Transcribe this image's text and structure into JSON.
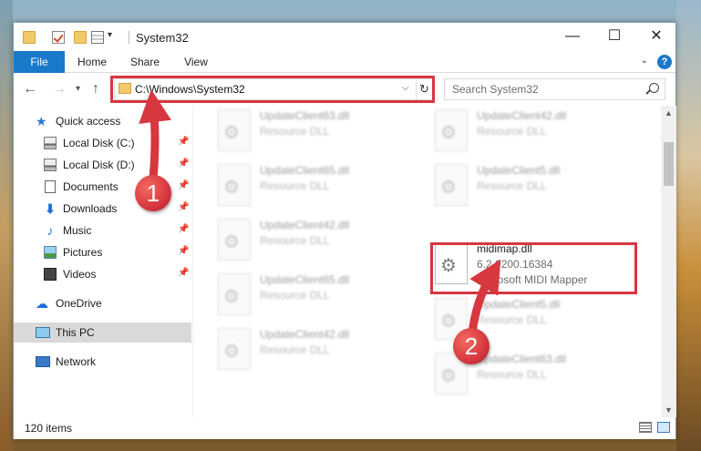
{
  "window": {
    "title": "System32",
    "controls": {
      "minimize": "—",
      "maximize": "☐",
      "close": "✕"
    }
  },
  "ribbon": {
    "tabs": [
      "File",
      "Home",
      "Share",
      "View"
    ],
    "help": "?"
  },
  "address": {
    "path": "C:\\Windows\\System32",
    "refresh_glyph": "↻"
  },
  "search": {
    "placeholder": "Search System32"
  },
  "nav_pane": {
    "quick_access": "Quick access",
    "pinned": [
      {
        "label": "Local Disk (C:)"
      },
      {
        "label": "Local Disk (D:)"
      },
      {
        "label": "Documents"
      },
      {
        "label": "Downloads"
      },
      {
        "label": "Music"
      },
      {
        "label": "Pictures"
      },
      {
        "label": "Videos"
      }
    ],
    "onedrive": "OneDrive",
    "this_pc": "This PC",
    "network": "Network"
  },
  "files": [
    {
      "name": "UpdateClient63.dll",
      "type": "Resource DLL"
    },
    {
      "name": "UpdateClient42.dll",
      "type": "Resource DLL"
    },
    {
      "name": "UpdateClient65.dll",
      "type": "Resource DLL"
    },
    {
      "name": "UpdateClient5.dll",
      "type": "Resource DLL"
    },
    {
      "name": "UpdateClient42.dll",
      "type": "Resource DLL"
    },
    {
      "name": "midimap.dll",
      "version": "6.2.9200.16384",
      "description": "Microsoft MIDI Mapper"
    },
    {
      "name": "UpdateClient65.dll",
      "type": "Resource DLL"
    },
    {
      "name": "UpdateClient5.dll",
      "type": "Resource DLL"
    },
    {
      "name": "UpdateClient42.dll",
      "type": "Resource DLL"
    },
    {
      "name": "UpdateClient63.dll",
      "type": "Resource DLL"
    }
  ],
  "status": {
    "item_count": "120 items"
  },
  "annotations": {
    "marker_1": "1",
    "marker_2": "2",
    "color": "#d7373f"
  }
}
